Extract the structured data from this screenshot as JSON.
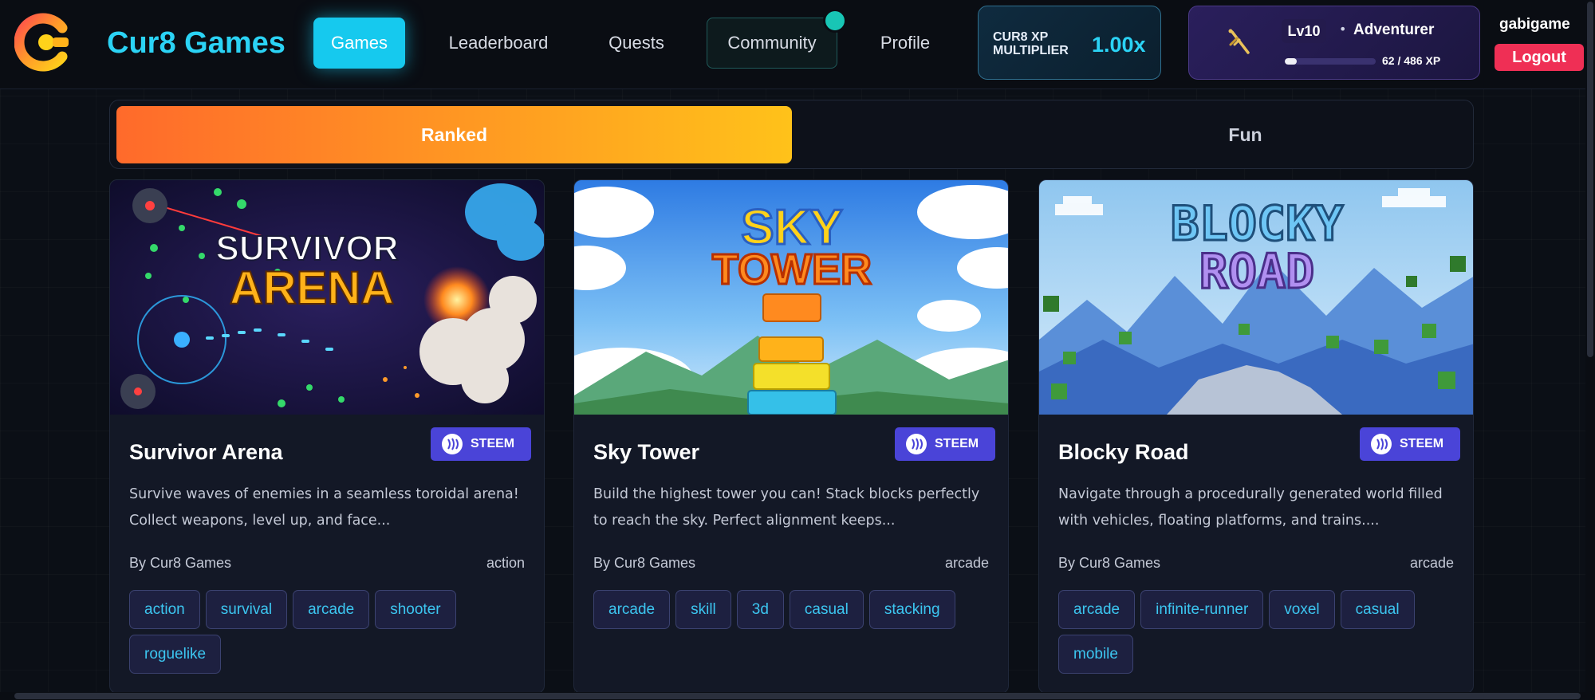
{
  "brand": {
    "name": "Cur8 Games"
  },
  "nav": {
    "games": "Games",
    "leaderboard": "Leaderboard",
    "quests": "Quests",
    "community": "Community",
    "profile": "Profile"
  },
  "xp_multiplier": {
    "label": "CUR8 XP MULTIPLIER",
    "value": "1.00x"
  },
  "level": {
    "badge": "Lv10",
    "separator": "•",
    "title": "Adventurer",
    "xp_text": "62 / 486 XP",
    "xp_progress": 0.13
  },
  "user": {
    "username": "gabigame",
    "logout_label": "Logout"
  },
  "mode": {
    "ranked": "Ranked",
    "fun": "Fun",
    "active": "ranked"
  },
  "games": [
    {
      "title": "Survivor Arena",
      "badge": "STEEM",
      "description": "Survive waves of enemies in a seamless toroidal arena! Collect weapons, level up, and face...",
      "author": "By Cur8 Games",
      "genre": "action",
      "tags": [
        "action",
        "survival",
        "arcade",
        "shooter",
        "roguelike"
      ],
      "art_line1": "SURVIVOR",
      "art_line2": "ARENA"
    },
    {
      "title": "Sky Tower",
      "badge": "STEEM",
      "description": "Build the highest tower you can! Stack blocks perfectly to reach the sky. Perfect alignment keeps...",
      "author": "By Cur8 Games",
      "genre": "arcade",
      "tags": [
        "arcade",
        "skill",
        "3d",
        "casual",
        "stacking"
      ],
      "art_line1": "SKY",
      "art_line2": "TOWER"
    },
    {
      "title": "Blocky Road",
      "badge": "STEEM",
      "description": "Navigate through a procedurally generated world filled with vehicles, floating platforms, and trains....",
      "author": "By Cur8 Games",
      "genre": "arcade",
      "tags": [
        "arcade",
        "infinite-runner",
        "voxel",
        "casual",
        "mobile"
      ],
      "art_line1": "BLOCKY",
      "art_line2": "ROAD"
    }
  ]
}
